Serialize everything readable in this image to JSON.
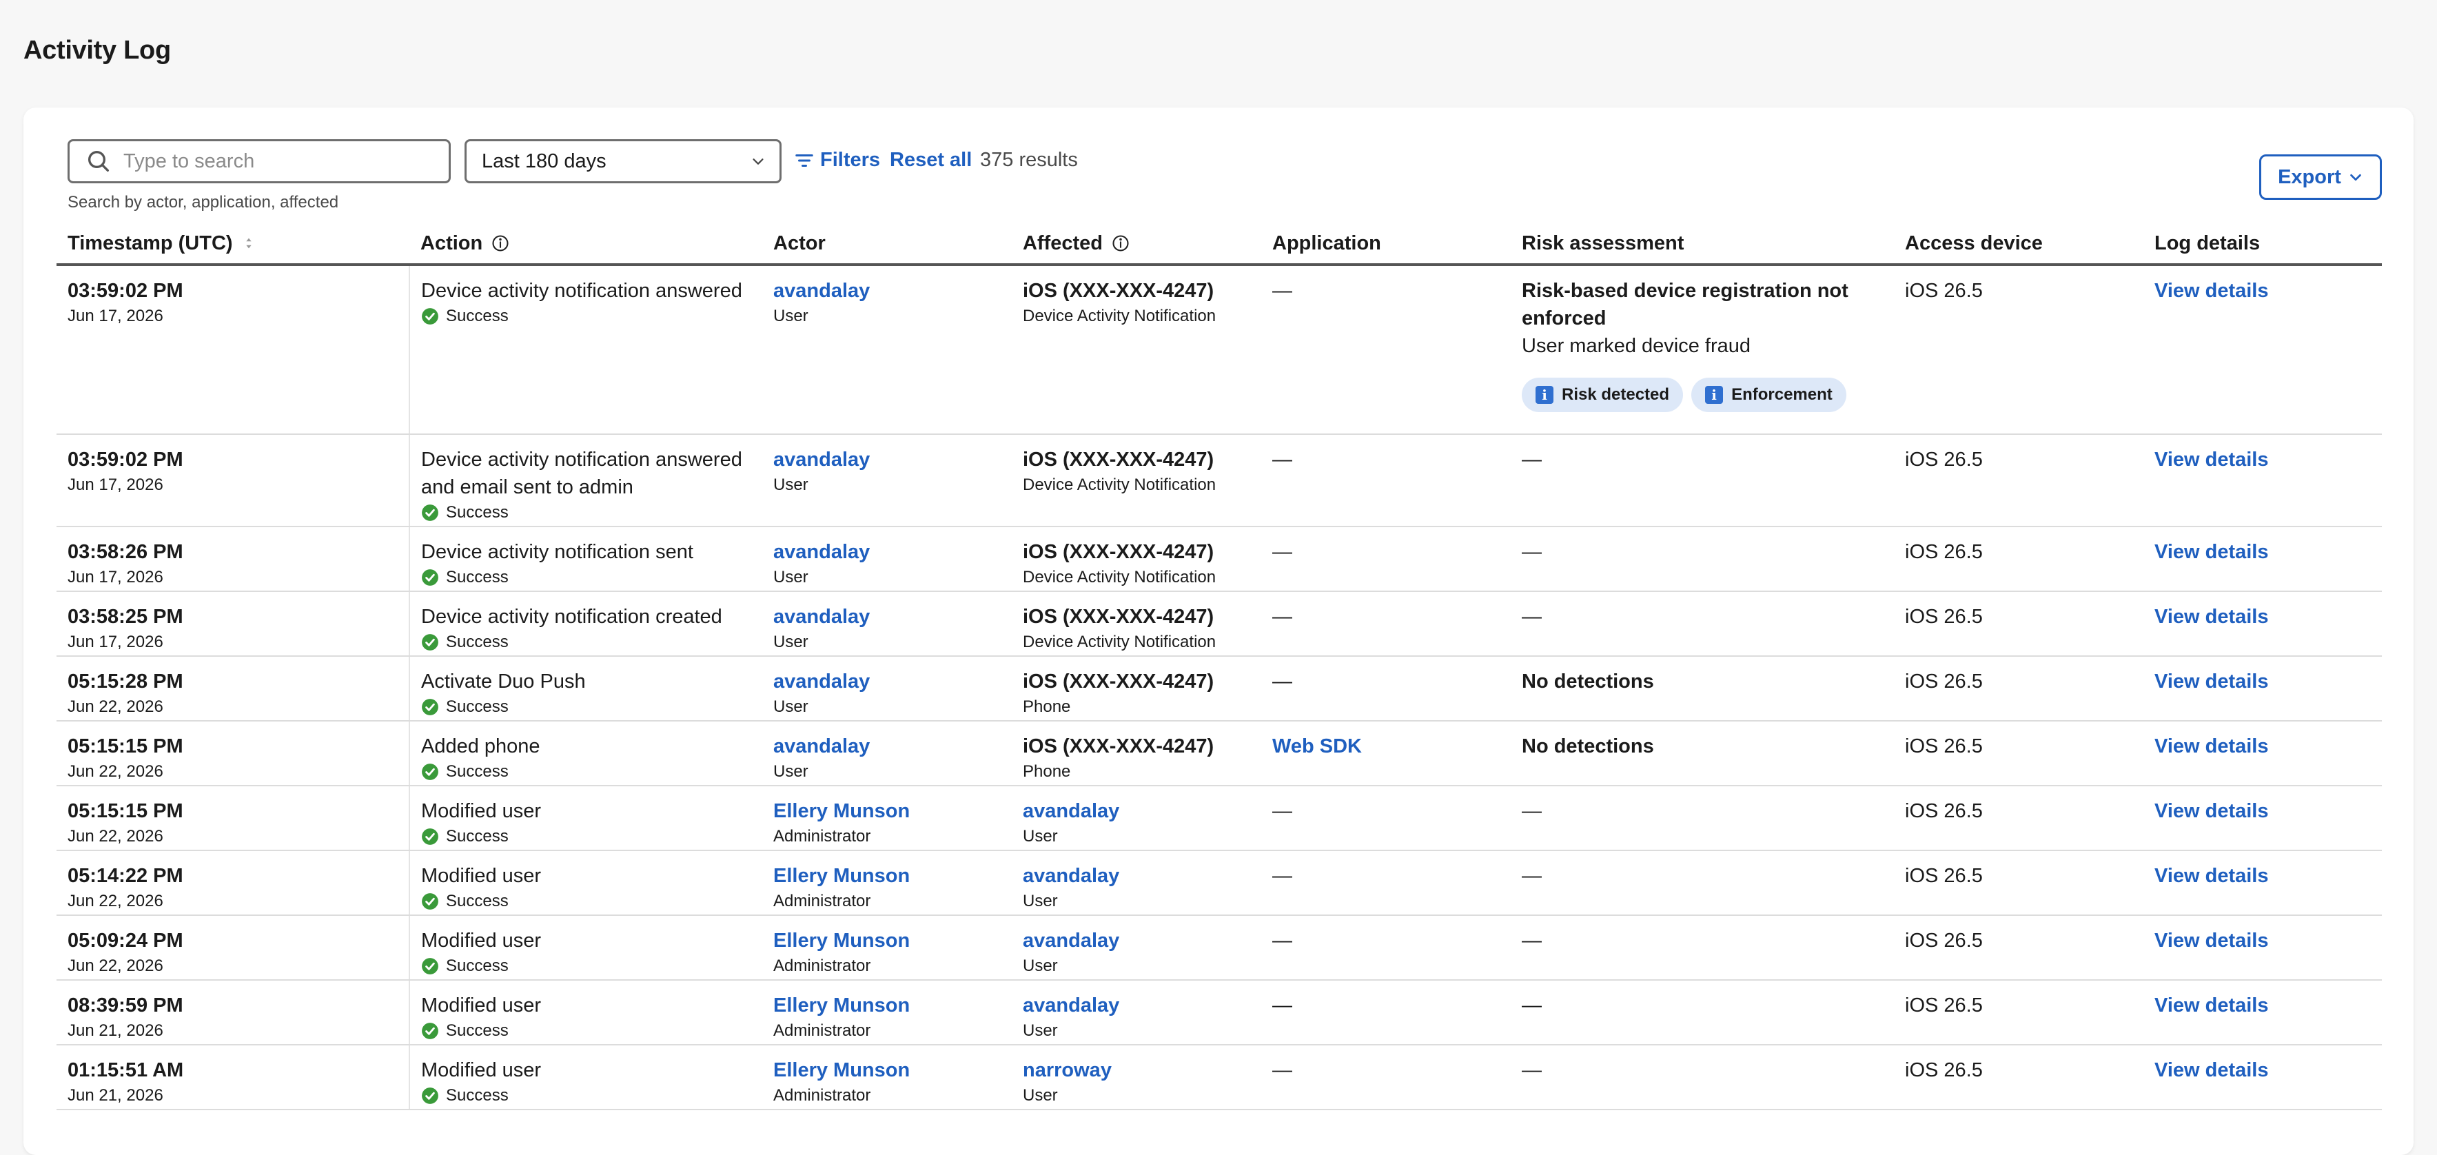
{
  "page": {
    "title": "Activity Log"
  },
  "toolbar": {
    "search_placeholder": "Type to search",
    "search_hint": "Search by actor, application, affected",
    "date_range": "Last 180 days",
    "filters_label": "Filters",
    "reset_label": "Reset all",
    "results": "375 results",
    "export_label": "Export"
  },
  "columns": {
    "timestamp": "Timestamp (UTC)",
    "action": "Action",
    "actor": "Actor",
    "affected": "Affected",
    "application": "Application",
    "risk": "Risk assessment",
    "access_device": "Access device",
    "log_details": "Log details"
  },
  "rows": [
    {
      "time": "03:59:02 PM",
      "date": "Jun 17, 2026",
      "action": "Device activity notification answered",
      "status": "Success",
      "actor": "avandalay",
      "actor_role": "User",
      "affected": "iOS (XXX-XXX-4247)",
      "affected_type": "Device Activity Notification",
      "application": "—",
      "risk_title": "Risk-based device registration not enforced",
      "risk_sub": "User marked device fraud",
      "tags": [
        "Risk detected",
        "Enforcement"
      ],
      "device": "iOS 26.5",
      "details": "View details"
    },
    {
      "time": "03:59:02 PM",
      "date": "Jun 17, 2026",
      "action": "Device activity notification answered and email sent to admin",
      "status": "Success",
      "actor": "avandalay",
      "actor_role": "User",
      "affected": "iOS (XXX-XXX-4247)",
      "affected_type": "Device Activity Notification",
      "application": "—",
      "risk_title": "—",
      "device": "iOS 26.5",
      "details": "View details"
    },
    {
      "time": "03:58:26 PM",
      "date": "Jun 17, 2026",
      "action": "Device activity notification sent",
      "status": "Success",
      "actor": "avandalay",
      "actor_role": "User",
      "affected": "iOS (XXX-XXX-4247)",
      "affected_type": "Device Activity Notification",
      "application": "—",
      "risk_title": "—",
      "device": "iOS 26.5",
      "details": "View details"
    },
    {
      "time": "03:58:25 PM",
      "date": "Jun 17, 2026",
      "action": "Device activity notification created",
      "status": "Success",
      "actor": "avandalay",
      "actor_role": "User",
      "affected": "iOS (XXX-XXX-4247)",
      "affected_type": "Device Activity Notification",
      "application": "—",
      "risk_title": "—",
      "device": "iOS 26.5",
      "details": "View details"
    },
    {
      "time": "05:15:28 PM",
      "date": "Jun 22, 2026",
      "action": "Activate Duo Push",
      "status": "Success",
      "actor": "avandalay",
      "actor_role": "User",
      "affected": "iOS (XXX-XXX-4247)",
      "affected_type": "Phone",
      "application": "—",
      "risk_title": "No detections",
      "device": "iOS 26.5",
      "details": "View details"
    },
    {
      "time": "05:15:15 PM",
      "date": "Jun 22, 2026",
      "action": "Added phone",
      "status": "Success",
      "actor": "avandalay",
      "actor_role": "User",
      "affected": "iOS (XXX-XXX-4247)",
      "affected_type": "Phone",
      "application": "Web SDK",
      "risk_title": "No detections",
      "device": "iOS 26.5",
      "details": "View details"
    },
    {
      "time": "05:15:15 PM",
      "date": "Jun 22, 2026",
      "action": "Modified user",
      "status": "Success",
      "actor": "Ellery Munson",
      "actor_role": "Administrator",
      "affected": "avandalay",
      "affected_type": "User",
      "application": "—",
      "risk_title": "—",
      "device": "iOS 26.5",
      "details": "View details"
    },
    {
      "time": "05:14:22 PM",
      "date": "Jun 22, 2026",
      "action": "Modified user",
      "status": "Success",
      "actor": "Ellery Munson",
      "actor_role": "Administrator",
      "affected": "avandalay",
      "affected_type": "User",
      "application": "—",
      "risk_title": "—",
      "device": "iOS 26.5",
      "details": "View details"
    },
    {
      "time": "05:09:24 PM",
      "date": "Jun 22, 2026",
      "action": "Modified user",
      "status": "Success",
      "actor": "Ellery Munson",
      "actor_role": "Administrator",
      "affected": "avandalay",
      "affected_type": "User",
      "application": "—",
      "risk_title": "—",
      "device": "iOS 26.5",
      "details": "View details"
    },
    {
      "time": "08:39:59 PM",
      "date": "Jun 21, 2026",
      "action": "Modified user",
      "status": "Success",
      "actor": "Ellery Munson",
      "actor_role": "Administrator",
      "affected": "avandalay",
      "affected_type": "User",
      "application": "—",
      "risk_title": "—",
      "device": "iOS 26.5",
      "details": "View details"
    },
    {
      "time": "01:15:51 AM",
      "date": "Jun 21, 2026",
      "action": "Modified user",
      "status": "Success",
      "actor": "Ellery Munson",
      "actor_role": "Administrator",
      "affected": "narroway",
      "affected_type": "User",
      "application": "—",
      "risk_title": "—",
      "device": "iOS 26.5",
      "details": "View details"
    }
  ],
  "colors": {
    "link": "#1f5fbf",
    "success": "#3a9a3a",
    "tag_bg": "#dde8f8",
    "tag_icon": "#2f6fd0"
  },
  "icons": {
    "search": "search-icon",
    "filter": "filter-icon",
    "info": "info-icon",
    "sort": "sort-icon",
    "status": "check-circle-icon",
    "tag": "info-square-icon"
  }
}
